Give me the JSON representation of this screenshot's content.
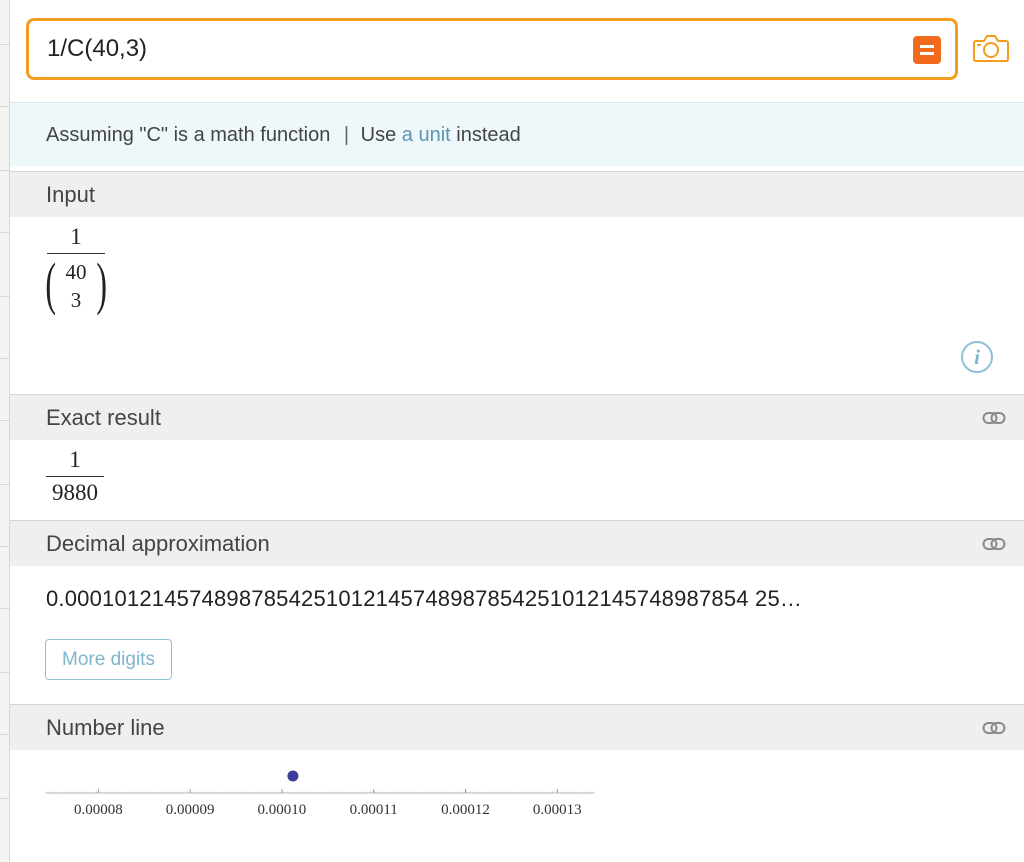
{
  "query": {
    "input_value": "1/C(40,3)"
  },
  "icons": {
    "compute": "equals-icon",
    "camera": "camera-icon",
    "info": "info-icon",
    "permalink": "link-icon"
  },
  "colors": {
    "accent_orange": "#f29d20",
    "compute_button": "#f26b1d",
    "link_blue": "#5e95ae",
    "point": "#3b3b9a"
  },
  "assumption": {
    "text_before": "Assuming \"C\" is a math function",
    "separator": "|",
    "use_label": "Use",
    "link_label": "a unit",
    "text_after": "instead"
  },
  "pods": {
    "input": {
      "title": "Input",
      "numerator": "1",
      "binom_top": "40",
      "binom_bottom": "3"
    },
    "exact": {
      "title": "Exact result",
      "numerator": "1",
      "denominator": "9880"
    },
    "decimal": {
      "title": "Decimal approximation",
      "value": "0.0001012145748987854251012145748987854251012145748987854 25…",
      "more_digits_label": "More digits"
    },
    "number_line": {
      "title": "Number line"
    }
  },
  "chart_data": {
    "type": "scatter",
    "title": "",
    "xlabel": "",
    "ylabel": "",
    "x_tick_labels": [
      "0.00008",
      "0.00009",
      "0.00010",
      "0.00011",
      "0.00012",
      "0.00013"
    ],
    "xlim": [
      7.43e-05,
      0.000134
    ],
    "points": [
      0.0001012
    ]
  }
}
